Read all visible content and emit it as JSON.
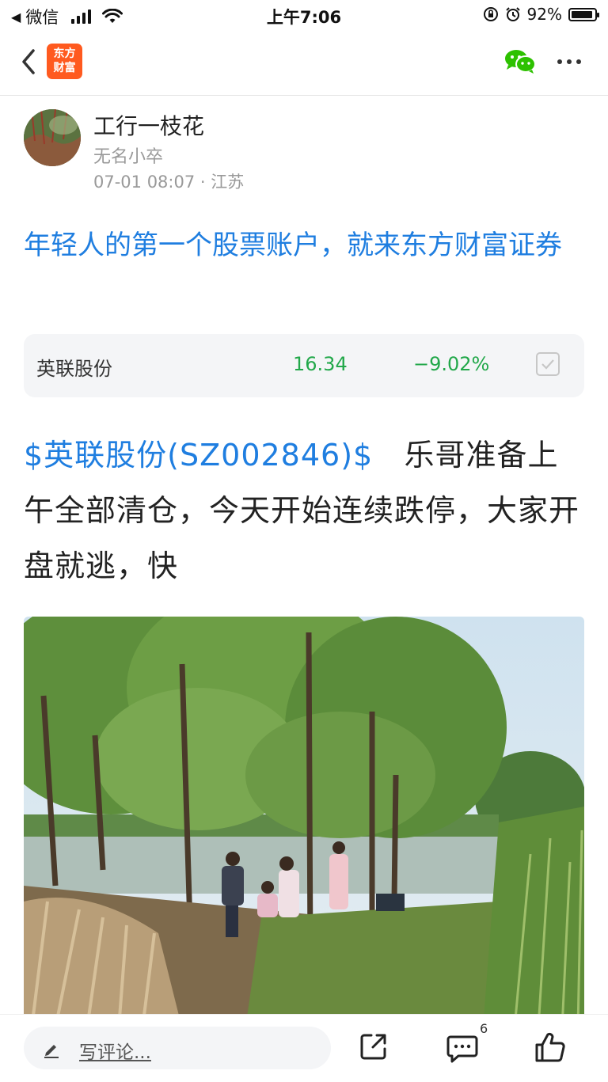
{
  "status_bar": {
    "back_app": "微信",
    "time": "上午7:06",
    "battery_percent": "92%",
    "battery_level": 0.92
  },
  "nav": {
    "logo_line1": "东方",
    "logo_line2": "财富",
    "icons": [
      "back-icon",
      "wechat-icon",
      "more-icon"
    ]
  },
  "author": {
    "name": "工行一枝花",
    "tag": "无名小卒",
    "meta": "07-01 08:07 · 江苏"
  },
  "headline": "年轻人的第一个股票账户，就来东方财富证券",
  "stock_card": {
    "name": "英联股份",
    "price": "16.34",
    "change": "−9.02%",
    "change_color": "#22a84a"
  },
  "post": {
    "stock_link": "$英联股份(SZ002846)$",
    "text": "乐哥准备上午全部清仓，今天开始连续跌停，大家开盘就逃，快"
  },
  "bottom_bar": {
    "comment_placeholder": "写评论...",
    "comment_count": "6",
    "icons": [
      "pencil-icon",
      "share-icon",
      "comment-icon",
      "like-icon"
    ]
  },
  "colors": {
    "link": "#1f7ee0",
    "stock_down": "#22a84a",
    "brand": "#ff5a1f"
  }
}
